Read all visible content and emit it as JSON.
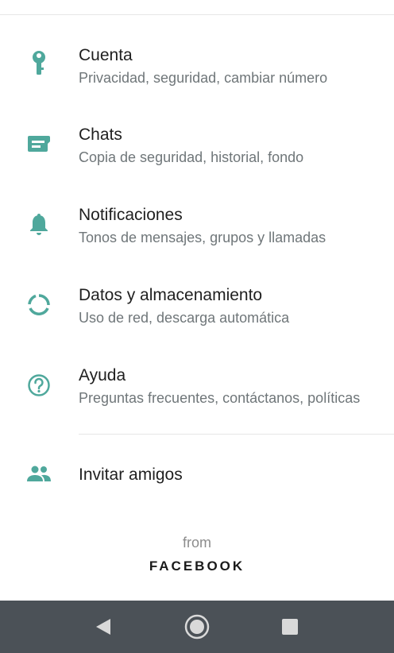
{
  "settings": {
    "items": [
      {
        "icon": "key-icon",
        "title": "Cuenta",
        "subtitle": "Privacidad, seguridad, cambiar número"
      },
      {
        "icon": "chat-icon",
        "title": "Chats",
        "subtitle": "Copia de seguridad, historial, fondo"
      },
      {
        "icon": "bell-icon",
        "title": "Notificaciones",
        "subtitle": "Tonos de mensajes, grupos y llamadas"
      },
      {
        "icon": "data-usage-icon",
        "title": "Datos y almacenamiento",
        "subtitle": "Uso de red, descarga automática"
      },
      {
        "icon": "help-icon",
        "title": "Ayuda",
        "subtitle": "Preguntas frecuentes, contáctanos, políticas"
      }
    ],
    "invite": {
      "icon": "people-icon",
      "title": "Invitar amigos"
    }
  },
  "footer": {
    "from_label": "from",
    "brand": "FACEBOOK"
  },
  "navbar": {
    "buttons": [
      "back-icon",
      "home-icon",
      "recents-icon"
    ]
  },
  "colors": {
    "icon_accent": "#4fa89c",
    "title_text": "#1f1f1f",
    "subtitle_text": "#6f7679",
    "navbar_bg": "#4b5157"
  }
}
